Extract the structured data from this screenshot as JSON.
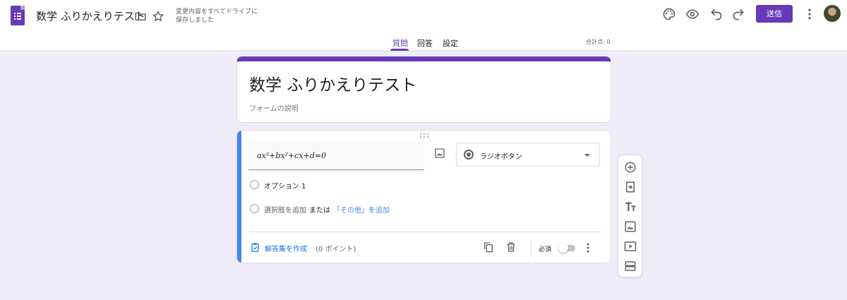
{
  "header": {
    "title": "数学 ふりかえりテスト",
    "save_status": "変更内容をすべてドライブに保存しました",
    "send_label": "送信",
    "icons": [
      "folder-icon",
      "star-icon",
      "palette-icon",
      "preview-icon",
      "undo-icon",
      "redo-icon",
      "more-vert-icon"
    ]
  },
  "tabs": [
    {
      "label": "質問",
      "active": true
    },
    {
      "label": "回答",
      "active": false
    },
    {
      "label": "設定",
      "active": false
    }
  ],
  "total_points": "合計点: 0",
  "form": {
    "title": "数学 ふりかえりテスト",
    "description_placeholder": "フォームの説明"
  },
  "question": {
    "text": "ax³+bx²+cx+d=0",
    "type": "ラジオボタン",
    "options": [
      "オプション 1"
    ],
    "add_option": "選択肢を追加",
    "or": "または",
    "add_other": "「その他」を追加",
    "answer_key": "解答集を作成",
    "points": "(0 ポイント)",
    "required_label": "必須",
    "required": false
  },
  "colors": {
    "accent": "#673ab7",
    "background": "#f0ebf8",
    "active_question": "#4285f4",
    "link": "#1a73e8"
  }
}
